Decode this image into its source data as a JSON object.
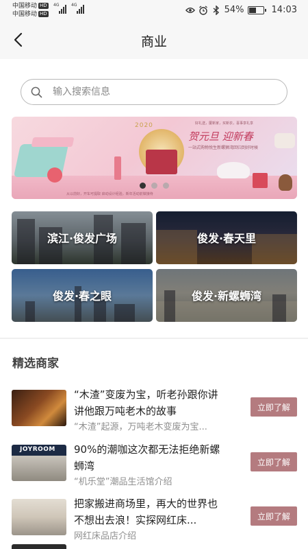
{
  "status_bar": {
    "carrier_1": "中国移动",
    "carrier_2": "中国移动",
    "hd_badge": "HD",
    "network_1": "4G",
    "network_2": "4G",
    "battery_percent": "54%",
    "battery_level": 0.54,
    "time": "14:03"
  },
  "nav": {
    "title": "商业"
  },
  "search": {
    "placeholder": "输入搜索信息",
    "value": ""
  },
  "banner": {
    "year": "2020",
    "headline": "贺元旦 迎新春",
    "top_text": "好礼送，厦新家，买新衣，喜事享礼享",
    "subline": "一站式购物悦生新螺狮湾回归到好时候",
    "footer": "从以前好，开车可提取 启动设计经验，新年活动前做接待",
    "page_count": 3,
    "active_page": 0
  },
  "plazas": [
    {
      "label": "滨江·俊发广场"
    },
    {
      "label": "俊发·春天里"
    },
    {
      "label": "俊发·春之眼"
    },
    {
      "label": "俊发·新螺蛳湾"
    }
  ],
  "merchants": {
    "section_title": "精选商家",
    "items": [
      {
        "title": "“木渣”变废为宝，听老孙跟你讲讲他跟万吨老木的故事",
        "desc": "“木渣”起源，万吨老木变废为宝...",
        "button": "立即了解",
        "thumb_text": ""
      },
      {
        "title": "90%的潮咖这次都无法拒绝新螺蛳湾",
        "desc": "“机乐堂”潮品生活馆介绍",
        "button": "立即了解",
        "thumb_text": "JOYROOM"
      },
      {
        "title": "把家搬进商场里，再大的世界也不想出去浪！实探网红床...",
        "desc": "网红床品店介绍",
        "button": "立即了解",
        "thumb_text": ""
      }
    ]
  },
  "colors": {
    "accent_button": "#b47b7f",
    "page_bg": "#ffffff",
    "bar_bg": "#f7f7f7"
  },
  "icons": [
    "back-arrow-icon",
    "search-icon",
    "eye-icon",
    "alarm-icon",
    "bluetooth-icon",
    "battery-icon",
    "signal-icon"
  ]
}
